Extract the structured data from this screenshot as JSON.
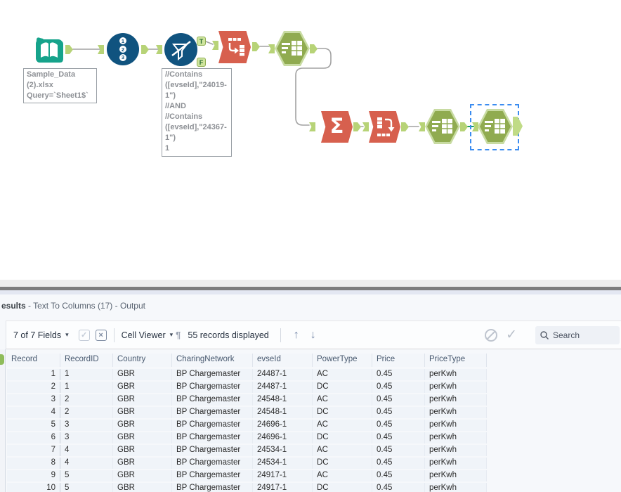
{
  "canvas": {
    "annotations": {
      "input": "Sample_Data\n(2).xlsx\nQuery=`Sheet1$`",
      "filter": "//Contains\n([evseId],\"24019-\n1\")\n//AND\n//Contains\n([evseId],\"24367-\n1\")\n1"
    },
    "filter": {
      "true_label": "T",
      "false_label": "F"
    },
    "colors": {
      "input_teal": "#16a38b",
      "tool_blue": "#10537f",
      "tool_red": "#d7604e",
      "tool_green": "#90ab50",
      "anchor_green": "#b7d377",
      "selected_wire_green": "#18a05e",
      "selection_blue": "#3b8cf0"
    }
  },
  "results": {
    "title_bold": "esults",
    "title_rest": " - Text To Columns (17) - Output",
    "toolbar": {
      "fields_dropdown": "7 of 7 Fields",
      "cell_viewer": "Cell Viewer",
      "records_displayed": "55 records displayed",
      "search_placeholder": "Search"
    },
    "table": {
      "headers": [
        "Record",
        "RecordID",
        "Country",
        "CharingNetwork",
        "evseId",
        "PowerType",
        "Price",
        "PriceType"
      ],
      "rows": [
        [
          "1",
          "1",
          "GBR",
          "BP Chargemaster",
          "24487-1",
          "AC",
          "0.45",
          "perKwh"
        ],
        [
          "2",
          "1",
          "GBR",
          "BP Chargemaster",
          "24487-1",
          "DC",
          "0.45",
          "perKwh"
        ],
        [
          "3",
          "2",
          "GBR",
          "BP Chargemaster",
          "24548-1",
          "AC",
          "0.45",
          "perKwh"
        ],
        [
          "4",
          "2",
          "GBR",
          "BP Chargemaster",
          "24548-1",
          "DC",
          "0.45",
          "perKwh"
        ],
        [
          "5",
          "3",
          "GBR",
          "BP Chargemaster",
          "24696-1",
          "AC",
          "0.45",
          "perKwh"
        ],
        [
          "6",
          "3",
          "GBR",
          "BP Chargemaster",
          "24696-1",
          "DC",
          "0.45",
          "perKwh"
        ],
        [
          "7",
          "4",
          "GBR",
          "BP Chargemaster",
          "24534-1",
          "AC",
          "0.45",
          "perKwh"
        ],
        [
          "8",
          "4",
          "GBR",
          "BP Chargemaster",
          "24534-1",
          "DC",
          "0.45",
          "perKwh"
        ],
        [
          "9",
          "5",
          "GBR",
          "BP Chargemaster",
          "24917-1",
          "AC",
          "0.45",
          "perKwh"
        ],
        [
          "10",
          "5",
          "GBR",
          "BP Chargemaster",
          "24917-1",
          "DC",
          "0.45",
          "perKwh"
        ]
      ]
    }
  }
}
